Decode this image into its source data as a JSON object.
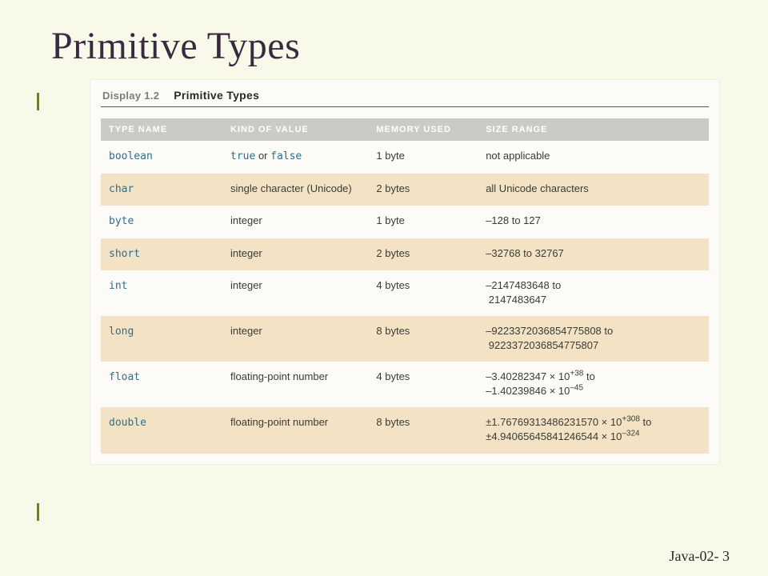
{
  "title": "Primitive Types",
  "display": {
    "label": "Display 1.2",
    "title": "Primitive Types"
  },
  "headers": {
    "type": "TYPE NAME",
    "kind": "KIND OF VALUE",
    "mem": "MEMORY USED",
    "range": "SIZE RANGE"
  },
  "rows": [
    {
      "type": "boolean",
      "kind_html": "<span class=\"mono\">true</span> <span class=\"plain\">or</span> <span class=\"mono\">false</span>",
      "mem": "1 byte",
      "range_html": "not applicable",
      "band": false
    },
    {
      "type": "char",
      "kind_html": "single character (Unicode)",
      "mem": "2 bytes",
      "range_html": "all Unicode characters",
      "band": true
    },
    {
      "type": "byte",
      "kind_html": "integer",
      "mem": "1 byte",
      "range_html": "–128 to 127",
      "band": false
    },
    {
      "type": "short",
      "kind_html": "integer",
      "mem": "2 bytes",
      "range_html": "–32768 to 32767",
      "band": true
    },
    {
      "type": "int",
      "kind_html": "integer",
      "mem": "4 bytes",
      "range_html": "–2147483648 to<br>&nbsp;2147483647",
      "band": false
    },
    {
      "type": "long",
      "kind_html": "integer",
      "mem": "8 bytes",
      "range_html": "–9223372036854775808 to<br>&nbsp;9223372036854775807",
      "band": true
    },
    {
      "type": "float",
      "kind_html": "floating-point number",
      "mem": "4 bytes",
      "range_html": "–3.40282347 × 10<sup>+38</sup> to<br>–1.40239846 × 10<sup>–45</sup>",
      "band": false
    },
    {
      "type": "double",
      "kind_html": "floating-point number",
      "mem": "8 bytes",
      "range_html": "±1.76769313486231570 × 10<sup>+308</sup> to<br>±4.94065645841246544 × 10<sup>–324</sup>",
      "band": true
    }
  ],
  "footer": "Java-02- 3",
  "chart_data": {
    "type": "table",
    "title": "Primitive Types",
    "columns": [
      "TYPE NAME",
      "KIND OF VALUE",
      "MEMORY USED",
      "SIZE RANGE"
    ],
    "rows": [
      [
        "boolean",
        "true or false",
        "1 byte",
        "not applicable"
      ],
      [
        "char",
        "single character (Unicode)",
        "2 bytes",
        "all Unicode characters"
      ],
      [
        "byte",
        "integer",
        "1 byte",
        "-128 to 127"
      ],
      [
        "short",
        "integer",
        "2 bytes",
        "-32768 to 32767"
      ],
      [
        "int",
        "integer",
        "4 bytes",
        "-2147483648 to 2147483647"
      ],
      [
        "long",
        "integer",
        "8 bytes",
        "-9223372036854775808 to 9223372036854775807"
      ],
      [
        "float",
        "floating-point number",
        "4 bytes",
        "-3.40282347e+38 to -1.40239846e-45"
      ],
      [
        "double",
        "floating-point number",
        "8 bytes",
        "±1.76769313486231570e+308 to ±4.94065645841246544e-324"
      ]
    ]
  }
}
